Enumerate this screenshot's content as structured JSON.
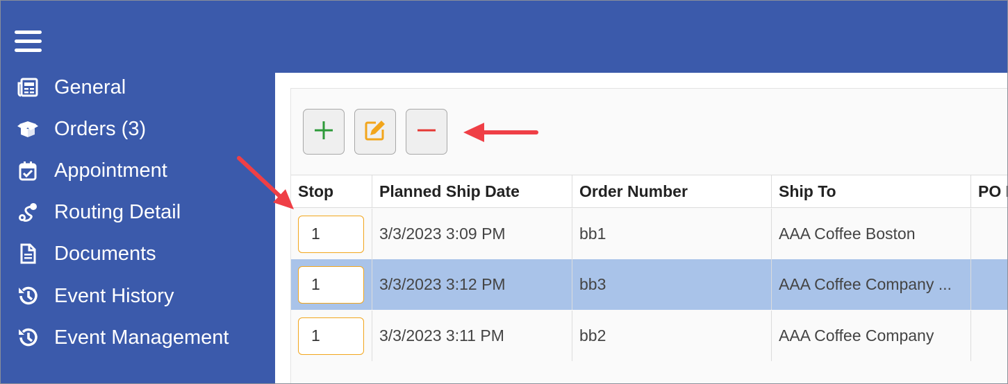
{
  "sidebar": {
    "menu_icon": "hamburger-menu-icon",
    "items": [
      {
        "label": "General",
        "icon": "newspaper-icon"
      },
      {
        "label": "Orders (3)",
        "icon": "open-box-icon"
      },
      {
        "label": "Appointment",
        "icon": "calendar-check-icon"
      },
      {
        "label": "Routing Detail",
        "icon": "route-icon"
      },
      {
        "label": "Documents",
        "icon": "document-icon"
      },
      {
        "label": "Event History",
        "icon": "history-icon"
      },
      {
        "label": "Event Management",
        "icon": "history-icon"
      }
    ]
  },
  "toolbar": {
    "add_icon": "plus-icon",
    "edit_icon": "edit-icon",
    "remove_icon": "minus-icon"
  },
  "colors": {
    "sidebar_bg": "#3b5aab",
    "add": "#2e9a3a",
    "edit": "#f2a51b",
    "remove": "#e53935",
    "selected_row": "#a9c3e9",
    "annotation_arrow": "#ef3f46"
  },
  "grid": {
    "columns": [
      "Stop",
      "Planned Ship Date",
      "Order Number",
      "Ship To",
      "PO N"
    ],
    "rows": [
      {
        "stop": "1",
        "planned_ship_date": "3/3/2023 3:09 PM",
        "order_number": "bb1",
        "ship_to": "AAA Coffee Boston",
        "selected": false
      },
      {
        "stop": "1",
        "planned_ship_date": "3/3/2023 3:12 PM",
        "order_number": "bb3",
        "ship_to": "AAA Coffee Company ...",
        "selected": true
      },
      {
        "stop": "1",
        "planned_ship_date": "3/3/2023 3:11 PM",
        "order_number": "bb2",
        "ship_to": "AAA Coffee Company",
        "selected": false
      }
    ]
  }
}
